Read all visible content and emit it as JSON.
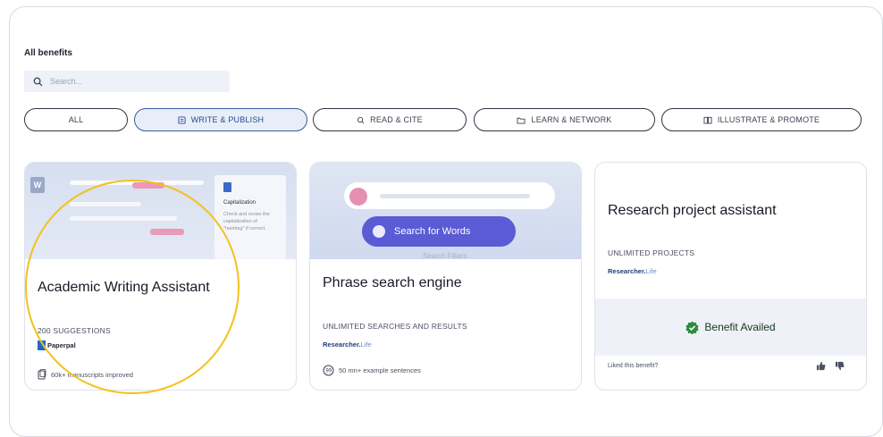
{
  "section": {
    "title": "All benefits",
    "search_placeholder": "Search..."
  },
  "tabs": [
    {
      "label": "ALL",
      "icon": "",
      "active": false
    },
    {
      "label": "WRITE & PUBLISH",
      "icon": "document-icon",
      "active": true
    },
    {
      "label": "READ & CITE",
      "icon": "search-doc-icon",
      "active": false
    },
    {
      "label": "LEARN & NETWORK",
      "icon": "folder-icon",
      "active": false
    },
    {
      "label": "ILLUSTRATE & PROMOTE",
      "icon": "book-icon",
      "active": false
    }
  ],
  "cards": [
    {
      "name": "Academic Writing Assistant",
      "subtitle": "200 SUGGESTIONS",
      "brand": "Paperpal",
      "footer": "60k+ manuscripts improved",
      "preview": {
        "word_badge": "W",
        "popup_title": "Capitalization",
        "popup_text": "Check and revise the capitalization of \"hashtag\" if correct."
      }
    },
    {
      "name": "Phrase search engine",
      "subtitle": "UNLIMITED SEARCHES AND RESULTS",
      "brand_bold": "Researcher.",
      "brand_light": "Life",
      "footer": "50 mn+ example sentences",
      "preview": {
        "search_button": "Search for Words",
        "ghost_text": "Search Filters"
      }
    },
    {
      "name": "Research project assistant",
      "subtitle": "UNLIMITED PROJECTS",
      "brand_bold": "Researcher.",
      "brand_light": "Life",
      "status": "Benefit Availed",
      "liked_prompt": "Liked this benefit?"
    }
  ],
  "colors": {
    "accent": "#274a8f",
    "highlight": "#f3c21b",
    "availed_green": "#2e8b3d",
    "purple": "#5b5bd6"
  }
}
